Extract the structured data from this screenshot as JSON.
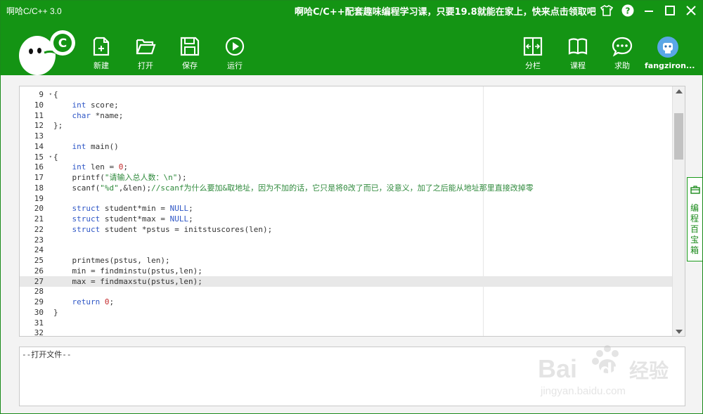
{
  "window": {
    "app_title": "啊哈C/C++ 3.0",
    "promo": "啊哈C/C++配套趣味编程学习课，只要19.8就能在家上，快来点击领取吧"
  },
  "toolbar": {
    "logo_letter": "C",
    "new_label": "新建",
    "open_label": "打开",
    "save_label": "保存",
    "run_label": "运行",
    "split_label": "分栏",
    "course_label": "课程",
    "help_label": "求助",
    "user_name": "fangziron..."
  },
  "editor": {
    "lines": [
      {
        "n": "9",
        "fold": "▾",
        "segs": [
          {
            "t": "{",
            "c": ""
          }
        ]
      },
      {
        "n": "10",
        "fold": "",
        "segs": [
          {
            "t": "    ",
            "c": ""
          },
          {
            "t": "int",
            "c": "kw"
          },
          {
            "t": " score;",
            "c": ""
          }
        ]
      },
      {
        "n": "11",
        "fold": "",
        "segs": [
          {
            "t": "    ",
            "c": ""
          },
          {
            "t": "char",
            "c": "kw"
          },
          {
            "t": " *name;",
            "c": ""
          }
        ]
      },
      {
        "n": "12",
        "fold": "",
        "segs": [
          {
            "t": "};",
            "c": ""
          }
        ]
      },
      {
        "n": "13",
        "fold": "",
        "segs": []
      },
      {
        "n": "14",
        "fold": "",
        "segs": [
          {
            "t": "    ",
            "c": ""
          },
          {
            "t": "int",
            "c": "kw"
          },
          {
            "t": " main()",
            "c": ""
          }
        ]
      },
      {
        "n": "15",
        "fold": "▾",
        "segs": [
          {
            "t": "{",
            "c": ""
          }
        ]
      },
      {
        "n": "16",
        "fold": "",
        "segs": [
          {
            "t": "    ",
            "c": ""
          },
          {
            "t": "int",
            "c": "kw"
          },
          {
            "t": " len = ",
            "c": ""
          },
          {
            "t": "0",
            "c": "num"
          },
          {
            "t": ";",
            "c": ""
          }
        ]
      },
      {
        "n": "17",
        "fold": "",
        "segs": [
          {
            "t": "    printf(",
            "c": ""
          },
          {
            "t": "\"请输入总人数：\\n\"",
            "c": "str"
          },
          {
            "t": ");",
            "c": ""
          }
        ]
      },
      {
        "n": "18",
        "fold": "",
        "segs": [
          {
            "t": "    scanf(",
            "c": ""
          },
          {
            "t": "\"%d\"",
            "c": "str"
          },
          {
            "t": ",&len);",
            "c": ""
          },
          {
            "t": "//scanf为什么要加&取地址，因为不加的话，它只是将0改了而已，没意义，加了之后能从地址那里直接改掉零",
            "c": "cmt"
          }
        ]
      },
      {
        "n": "19",
        "fold": "",
        "segs": []
      },
      {
        "n": "20",
        "fold": "",
        "segs": [
          {
            "t": "    ",
            "c": ""
          },
          {
            "t": "struct",
            "c": "kw"
          },
          {
            "t": " student*min = ",
            "c": ""
          },
          {
            "t": "NULL",
            "c": "kw"
          },
          {
            "t": ";",
            "c": ""
          }
        ]
      },
      {
        "n": "21",
        "fold": "",
        "segs": [
          {
            "t": "    ",
            "c": ""
          },
          {
            "t": "struct",
            "c": "kw"
          },
          {
            "t": " student*max = ",
            "c": ""
          },
          {
            "t": "NULL",
            "c": "kw"
          },
          {
            "t": ";",
            "c": ""
          }
        ]
      },
      {
        "n": "22",
        "fold": "",
        "segs": [
          {
            "t": "    ",
            "c": ""
          },
          {
            "t": "struct",
            "c": "kw"
          },
          {
            "t": " student *pstus = initstuscores(len);",
            "c": ""
          }
        ]
      },
      {
        "n": "23",
        "fold": "",
        "segs": []
      },
      {
        "n": "24",
        "fold": "",
        "segs": []
      },
      {
        "n": "25",
        "fold": "",
        "segs": [
          {
            "t": "    printmes(pstus, len);",
            "c": ""
          }
        ]
      },
      {
        "n": "26",
        "fold": "",
        "segs": [
          {
            "t": "    min = findminstu(pstus,len);",
            "c": ""
          }
        ]
      },
      {
        "n": "27",
        "fold": "",
        "current": true,
        "segs": [
          {
            "t": "    max = findmaxstu(pstus,len);",
            "c": ""
          }
        ]
      },
      {
        "n": "28",
        "fold": "",
        "segs": []
      },
      {
        "n": "29",
        "fold": "",
        "segs": [
          {
            "t": "    ",
            "c": ""
          },
          {
            "t": "return",
            "c": "kw"
          },
          {
            "t": " ",
            "c": ""
          },
          {
            "t": "0",
            "c": "num"
          },
          {
            "t": ";",
            "c": ""
          }
        ]
      },
      {
        "n": "30",
        "fold": "",
        "segs": [
          {
            "t": "}",
            "c": ""
          }
        ]
      },
      {
        "n": "31",
        "fold": "",
        "segs": []
      },
      {
        "n": "32",
        "fold": "",
        "segs": []
      }
    ]
  },
  "side_tab": {
    "label": "编程百宝箱"
  },
  "output": {
    "text": "--打开文件--"
  },
  "watermark": {
    "brand": "Bai",
    "brand2": "du",
    "cn": "经验",
    "url": "jingyan.baidu.com"
  },
  "colors": {
    "accent": "#149414",
    "keyword": "#2f57c6",
    "number": "#c4292b",
    "string": "#2f8a3c"
  }
}
